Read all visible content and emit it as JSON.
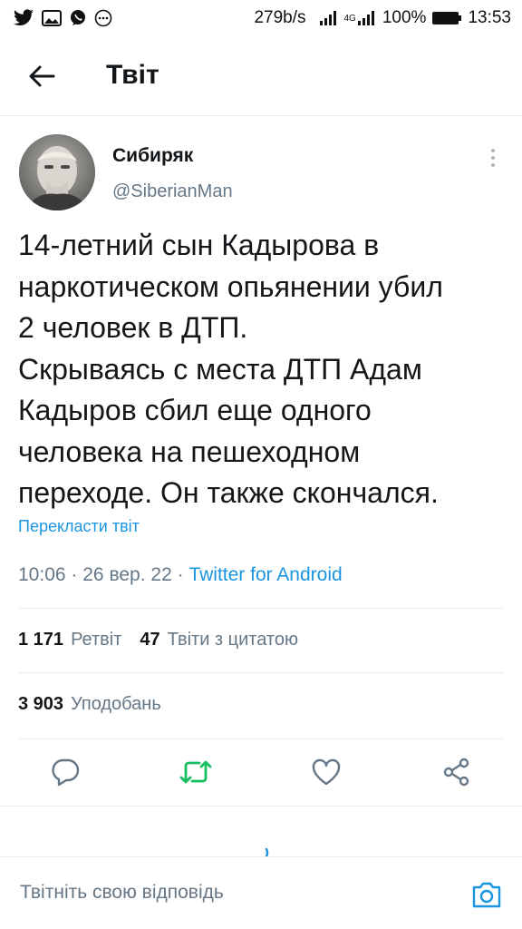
{
  "status_bar": {
    "speed": "279b/s",
    "network": "4G",
    "battery": "100%",
    "time": "13:53",
    "icons": [
      "twitter-icon",
      "gallery-icon",
      "viber-icon",
      "more-notifications-icon",
      "signal-icon",
      "signal-4g-icon",
      "battery-icon"
    ]
  },
  "header": {
    "title": "Твіт",
    "back_icon": "arrow-left-icon"
  },
  "tweet": {
    "author_name": "Сибиряк",
    "author_handle": "@SiberianMan",
    "text": "14-летний сын Кадырова в\nнаркотическом опьянении убил\n2 человек в ДТП.\nСкрываясь с места ДТП Адам\nКадыров сбил еще одного\nчеловека на пешеходном\nпереходе. Он также скончался.",
    "translate": "Перекласти твіт",
    "time": "10:06",
    "date": "26 вер. 22",
    "separator": "·",
    "source": "Twitter for Android"
  },
  "stats": {
    "retweets_count": "1 171",
    "retweets_label": "Ретвіт",
    "quotes_count": "47",
    "quotes_label": "Твіти з цитатою",
    "likes_count": "3 903",
    "likes_label": "Уподобань"
  },
  "actions": [
    "reply-icon",
    "retweet-icon",
    "like-icon",
    "share-icon"
  ],
  "colors": {
    "accent": "#1b95e0",
    "retweet_green": "#17bf63",
    "secondary_text": "#657786",
    "divider": "#e6ecf0"
  },
  "reply": {
    "placeholder": "Твітніть свою відповідь",
    "camera_icon": "camera-icon"
  }
}
